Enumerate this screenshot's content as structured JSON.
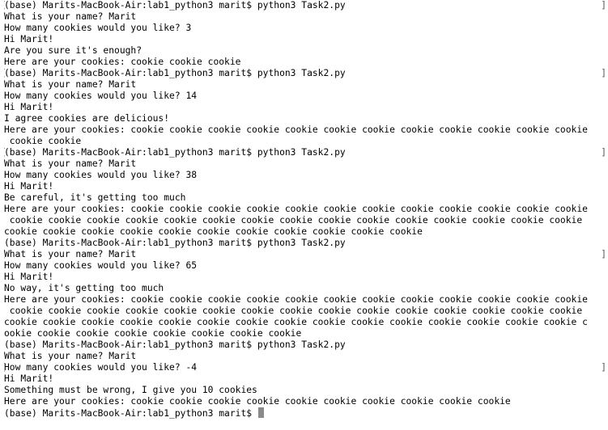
{
  "terminal": {
    "lines": [
      {
        "text": "(base) Marits-MacBook-Air:lab1_python3 marit$ python3 Task2.py",
        "lb": "[",
        "rb": "]"
      },
      {
        "text": "What is your name? Marit"
      },
      {
        "text": "How many cookies would you like? 3"
      },
      {
        "text": "Hi Marit!"
      },
      {
        "text": "Are you sure it's enough?"
      },
      {
        "text": "Here are your cookies: cookie cookie cookie"
      },
      {
        "text": "(base) Marits-MacBook-Air:lab1_python3 marit$ python3 Task2.py",
        "lb": "[",
        "rb": "]"
      },
      {
        "text": "What is your name? Marit"
      },
      {
        "text": "How many cookies would you like? 14"
      },
      {
        "text": "Hi Marit!"
      },
      {
        "text": "I agree cookies are delicious!"
      },
      {
        "text": "Here are your cookies: cookie cookie cookie cookie cookie cookie cookie cookie cookie cookie cookie cookie"
      },
      {
        "text": " cookie cookie"
      },
      {
        "text": "(base) Marits-MacBook-Air:lab1_python3 marit$ python3 Task2.py",
        "lb": "[",
        "rb": "]"
      },
      {
        "text": "What is your name? Marit"
      },
      {
        "text": "How many cookies would you like? 38"
      },
      {
        "text": "Hi Marit!"
      },
      {
        "text": "Be careful, it's getting too much"
      },
      {
        "text": "Here are your cookies: cookie cookie cookie cookie cookie cookie cookie cookie cookie cookie cookie cookie"
      },
      {
        "text": " cookie cookie cookie cookie cookie cookie cookie cookie cookie cookie cookie cookie cookie cookie cookie"
      },
      {
        "text": "cookie cookie cookie cookie cookie cookie cookie cookie cookie cookie cookie"
      },
      {
        "text": "(base) Marits-MacBook-Air:lab1_python3 marit$ python3 Task2.py"
      },
      {
        "text": "What is your name? Marit",
        "lb": "[",
        "rb": "]"
      },
      {
        "text": "How many cookies would you like? 65"
      },
      {
        "text": "Hi Marit!"
      },
      {
        "text": "No way, it's getting too much"
      },
      {
        "text": "Here are your cookies: cookie cookie cookie cookie cookie cookie cookie cookie cookie cookie cookie cookie"
      },
      {
        "text": " cookie cookie cookie cookie cookie cookie cookie cookie cookie cookie cookie cookie cookie cookie cookie"
      },
      {
        "text": "cookie cookie cookie cookie cookie cookie cookie cookie cookie cookie cookie cookie cookie cookie cookie c"
      },
      {
        "text": "ookie cookie cookie cookie cookie cookie cookie cookie"
      },
      {
        "text": "(base) Marits-MacBook-Air:lab1_python3 marit$ python3 Task2.py"
      },
      {
        "text": "What is your name? Marit"
      },
      {
        "text": "How many cookies would you like? -4",
        "lb": "[",
        "rb": "]"
      },
      {
        "text": "Hi Marit!"
      },
      {
        "text": "Something must be wrong, I give you 10 cookies"
      },
      {
        "text": "Here are your cookies: cookie cookie cookie cookie cookie cookie cookie cookie cookie cookie"
      },
      {
        "text": "(base) Marits-MacBook-Air:lab1_python3 marit$ ",
        "cursor": true
      }
    ]
  }
}
